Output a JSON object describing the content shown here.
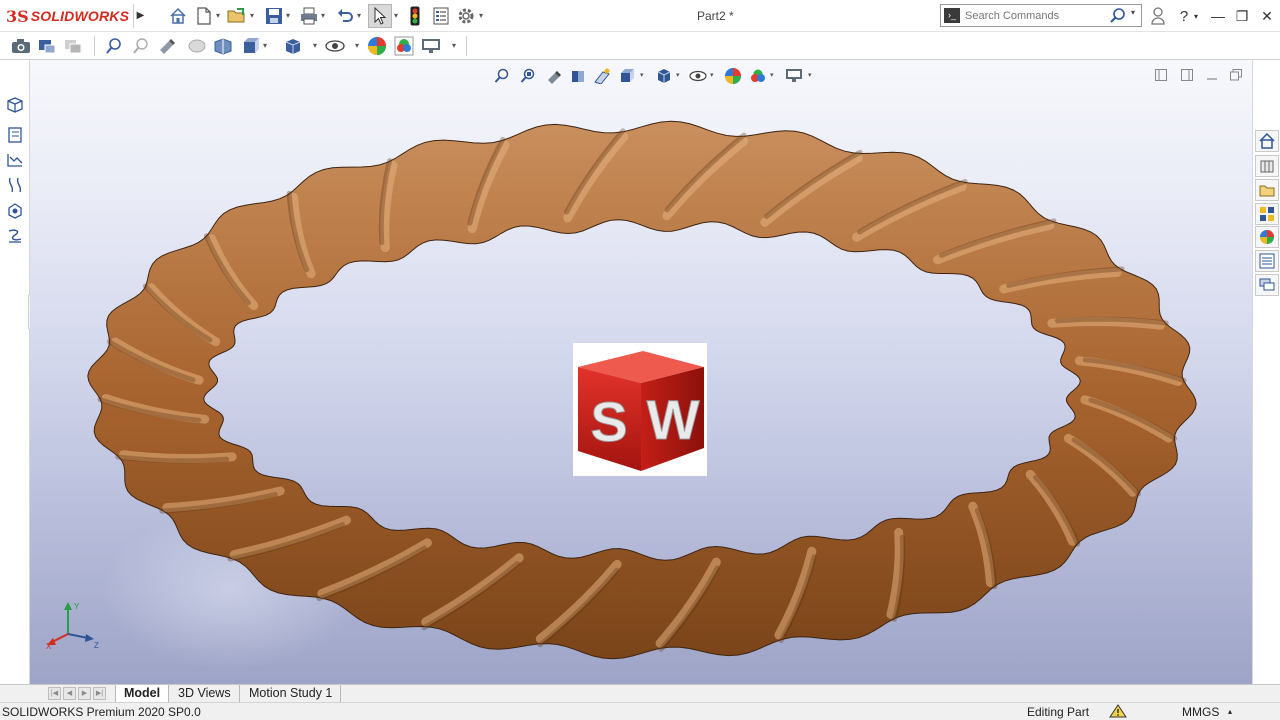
{
  "app": {
    "brand_prefix": "3S",
    "brand_name": "SOLIDWORKS",
    "document_title": "Part2 *"
  },
  "titlebar": {
    "icons": [
      "home-icon",
      "new-document-icon",
      "open-folder-icon",
      "save-icon",
      "print-icon",
      "undo-icon",
      "select-arrow-icon",
      "rebuild-traffic-light-icon",
      "file-properties-icon",
      "options-gear-icon"
    ]
  },
  "search": {
    "placeholder": "Search Commands"
  },
  "window_controls": {
    "user": "user-icon",
    "help": "?",
    "minimize": "—",
    "restore": "❐",
    "close": "✕"
  },
  "toolbar2": {
    "icons": [
      "camera-icon",
      "photo-view-icon",
      "copy-view-icon",
      "zoom-to-fit-icon",
      "zoom-area-icon",
      "rotate-view-icon",
      "section-view-icon",
      "view-orientation-icon",
      "standard-views-icon",
      "display-style-icon",
      "hide-show-icon",
      "appearance-icon",
      "scene-icon",
      "view-setting-icon"
    ]
  },
  "left_panel": {
    "icons": [
      "feature-manager-icon",
      "property-manager-icon",
      "configuration-manager-icon",
      "dimxpert-icon",
      "display-manager-icon",
      "cam-icon"
    ]
  },
  "heads_up": {
    "icons": [
      "zoom-to-fit-icon",
      "zoom-area-icon",
      "previous-view-icon",
      "section-view-icon",
      "dynamic-annotation-icon",
      "view-orientation-icon",
      "display-style-icon",
      "hide-show-items-icon",
      "edit-appearance-icon",
      "apply-scene-icon",
      "view-settings-icon"
    ]
  },
  "viewport_controls": {
    "icons": [
      "split-horizontal-icon",
      "split-vertical-icon",
      "minimize-viewport-icon",
      "restore-viewport-icon",
      "close-viewport-icon"
    ]
  },
  "task_pane": {
    "icons": [
      "solidworks-resources-icon",
      "design-library-icon",
      "file-explorer-icon",
      "view-palette-icon",
      "appearances-icon",
      "custom-properties-icon",
      "forum-icon"
    ]
  },
  "center_logo": {
    "letters": "SW"
  },
  "triad": {
    "x": "X",
    "y": "Y",
    "z": "Z"
  },
  "bottom_tabs": {
    "tabs": [
      {
        "label": "Model",
        "active": true
      },
      {
        "label": "3D Views",
        "active": false
      },
      {
        "label": "Motion Study 1",
        "active": false
      }
    ]
  },
  "status": {
    "version": "SOLIDWORKS Premium 2020 SP0.0",
    "mode": "Editing Part",
    "units": "MMGS"
  },
  "colors": {
    "brand_red": "#d52b1e",
    "torus_copper": "#b5713c",
    "viewport_top": "#f7f8fc",
    "viewport_bottom": "#9ea4c7"
  }
}
